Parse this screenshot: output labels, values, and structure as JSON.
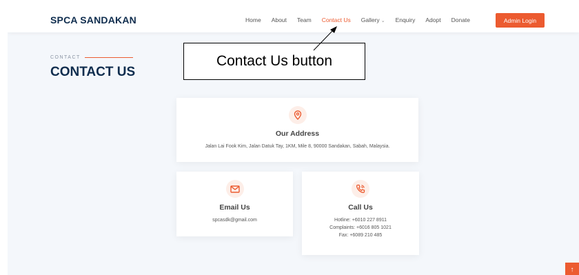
{
  "brand": "SPCA SANDAKAN",
  "nav": {
    "items": [
      "Home",
      "About",
      "Team",
      "Contact Us",
      "Gallery",
      "Enquiry",
      "Adopt",
      "Donate"
    ],
    "active": "Contact Us",
    "gallery_chevron": "chevron-down-icon",
    "admin_login": "Admin Login"
  },
  "section": {
    "eyebrow": "CONTACT",
    "title": "CONTACT US"
  },
  "cards": {
    "address": {
      "icon": "location-pin-icon",
      "title": "Our Address",
      "text": "Jalan Lai Fook Kim, Jalan Datuk Tay, 1KM, Mile 8, 90000 Sandakan, Sabah, Malaysia."
    },
    "email": {
      "icon": "envelope-icon",
      "title": "Email Us",
      "text": "spcasdk@gmail.com"
    },
    "call": {
      "icon": "phone-icon",
      "title": "Call Us",
      "hotline": "Hotline: +6010 227 8911",
      "complaints": "Complaints: +6016 805 1021",
      "fax": "Fax: +6089 210 485"
    }
  },
  "annotation": {
    "label": "Contact Us button"
  },
  "scroll_top_icon": "arrow-up-icon",
  "colors": {
    "accent": "#ec5b30",
    "brand": "#0f2d4e",
    "background": "#f4f7fb"
  }
}
